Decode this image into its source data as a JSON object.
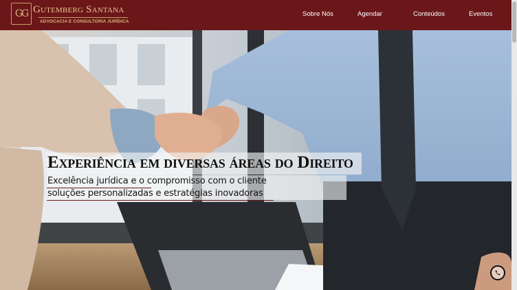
{
  "brand": {
    "monogram": "GG",
    "name": "Gutemberg Santana",
    "tagline": "ADVOCACIA E CONSULTORIA JURÍDICA"
  },
  "nav": {
    "items": [
      {
        "label": "Sobre Nós"
      },
      {
        "label": "Agendar"
      },
      {
        "label": "Conteúdos"
      },
      {
        "label": "Eventos"
      }
    ]
  },
  "hero": {
    "title": "Experiência em diversas áreas do Direito",
    "lines": [
      "Excelência jurídica e o compromisso com o cliente",
      "soluções personalizadas e estratégias inovadoras"
    ]
  },
  "colors": {
    "brand_maroon": "#6b1719",
    "gold": "#c9a063"
  },
  "icons": {
    "whatsapp": "whatsapp-icon"
  }
}
